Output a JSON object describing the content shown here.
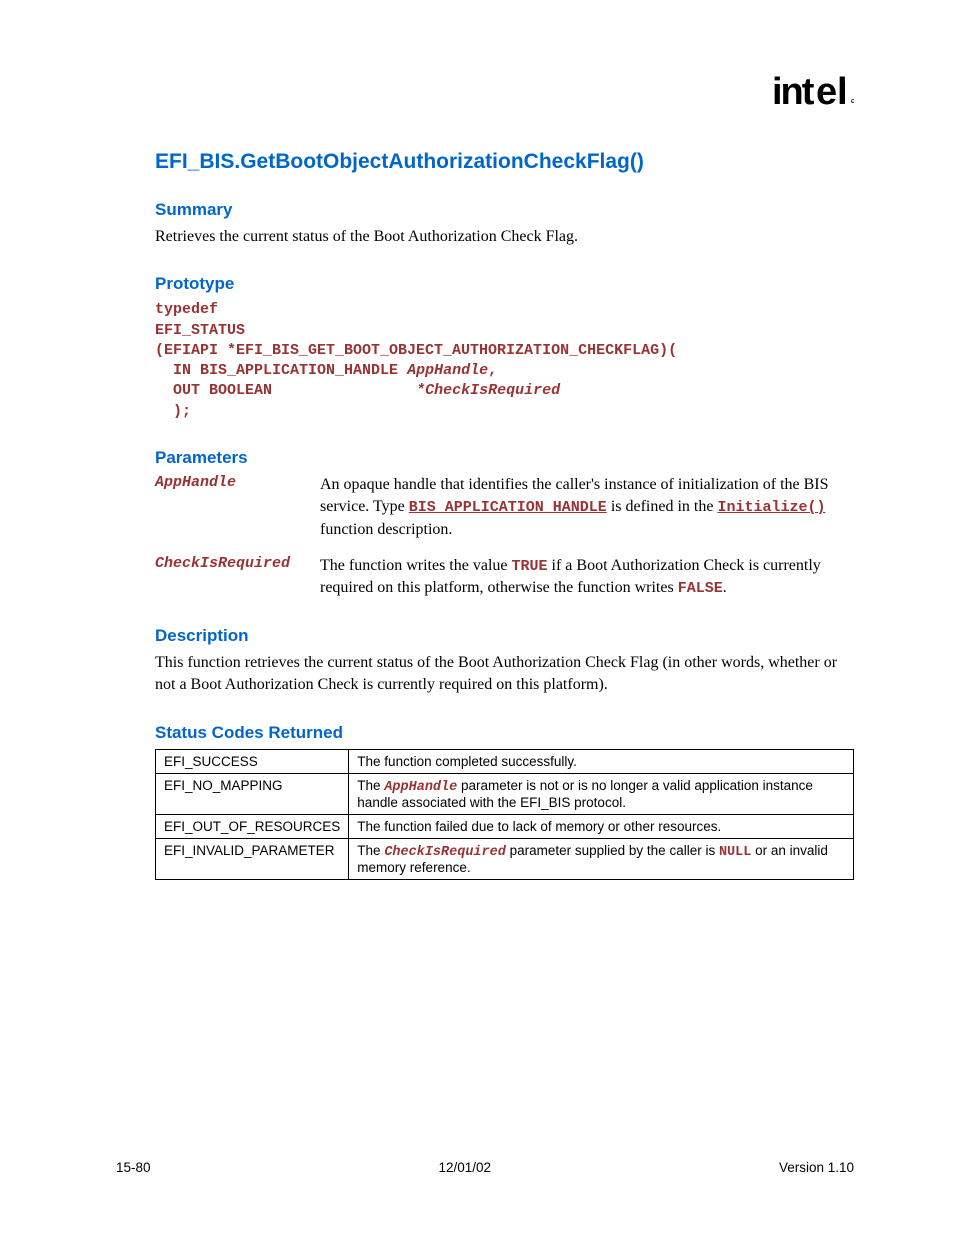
{
  "headings": {
    "function_name": "EFI_BIS.GetBootObjectAuthorizationCheckFlag()",
    "summary": "Summary",
    "prototype": "Prototype",
    "parameters": "Parameters",
    "description": "Description",
    "status_codes": "Status Codes Returned"
  },
  "summary_text": "Retrieves the current status of the Boot Authorization Check Flag.",
  "prototype": {
    "line1": "typedef",
    "line2": "EFI_STATUS",
    "line3": "(EFIAPI *EFI_BIS_GET_BOOT_OBJECT_AUTHORIZATION_CHECKFLAG)(",
    "line4a": "IN ",
    "line4b": " BIS_APPLICATION_HANDLE ",
    "line4c": " AppHandle",
    "line4d": ",",
    "line5a": "OUT BOOLEAN               ",
    "line5b": " *CheckIsRequired",
    "line6": ");"
  },
  "params": {
    "p1_name": "AppHandle",
    "p1_a": "An opaque handle that identifies the caller's instance of initialization of the BIS service.  Type ",
    "p1_b": "BIS_APPLICATION_HANDLE",
    "p1_c": " is defined in the ",
    "p1_d": "Initialize()",
    "p1_e": " function description.",
    "p2_name": "CheckIsRequired",
    "p2_a": "The function writes the value ",
    "p2_b": "TRUE",
    "p2_c": " if a Boot Authorization Check is currently required on this platform, otherwise the function writes ",
    "p2_d": "FALSE",
    "p2_e": "."
  },
  "description_text": "This function retrieves the current status of the Boot Authorization Check Flag (in other words, whether or not a Boot Authorization Check is currently required on this platform).",
  "status": {
    "r1c1": "EFI_SUCCESS",
    "r1c2": "The function completed successfully.",
    "r2c1": "EFI_NO_MAPPING",
    "r2c2a": "The ",
    "r2c2b": "AppHandle",
    "r2c2c": " parameter is not or is no longer a valid application instance handle associated with the EFI_BIS protocol.",
    "r3c1": "EFI_OUT_OF_RESOURCES",
    "r3c2": "The function failed due to lack of memory or other resources.",
    "r4c1": "EFI_INVALID_PARAMETER",
    "r4c2a": "The ",
    "r4c2b": "CheckIsRequired",
    "r4c2c": " parameter supplied by the caller is ",
    "r4c2d": "NULL",
    "r4c2e": " or an invalid memory reference."
  },
  "footer": {
    "left": "15-80",
    "center": "12/01/02",
    "right": "Version 1.10"
  }
}
